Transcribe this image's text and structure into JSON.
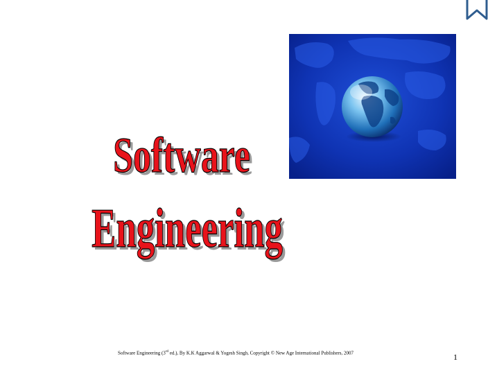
{
  "slide": {
    "title_line1": "Software",
    "title_line2": "Engineering",
    "footer_prefix": "Software Engineering (3",
    "footer_sup": "rd",
    "footer_suffix": " ed.), By K.K Aggarwal & Yogesh Singh, Copyright © New Age International Publishers, 2007",
    "page_number": "1"
  },
  "icons": {
    "bookmark": "bookmark-icon",
    "globe": "globe-image"
  },
  "colors": {
    "title_fill": "#e8131b",
    "title_shadow": "#9a9a9a",
    "title_outline": "#000000",
    "globe_background": "#0a2aa8",
    "bookmark_stroke": "#2f5d8f"
  }
}
